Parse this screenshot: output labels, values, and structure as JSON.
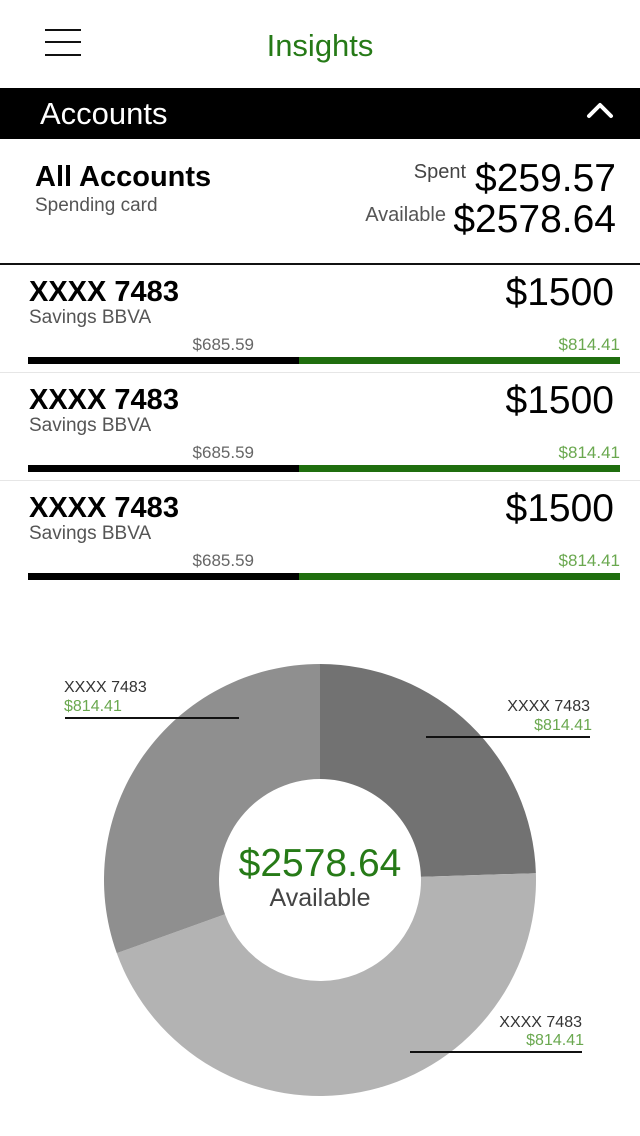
{
  "nav": {
    "title": "Insights"
  },
  "section": {
    "title": "Accounts"
  },
  "summary": {
    "title": "All Accounts",
    "subtitle": "Spending card",
    "spent_label": "Spent",
    "spent_value": "$259.57",
    "available_label": "Available",
    "available_value": "$2578.64"
  },
  "accounts": [
    {
      "name": "XXXX 7483",
      "type": "Savings BBVA",
      "limit": "$1500",
      "used": "$685.59",
      "available": "$814.41",
      "used_fraction": 0.457
    },
    {
      "name": "XXXX 7483",
      "type": "Savings BBVA",
      "limit": "$1500",
      "used": "$685.59",
      "available": "$814.41",
      "used_fraction": 0.457
    },
    {
      "name": "XXXX 7483",
      "type": "Savings BBVA",
      "limit": "$1500",
      "used": "$685.59",
      "available": "$814.41",
      "used_fraction": 0.457
    }
  ],
  "donut": {
    "center_value": "$2578.64",
    "center_label": "Available",
    "slices": [
      {
        "name": "XXXX 7483",
        "amount": "$814.41",
        "fraction": 0.245,
        "color": "#727272"
      },
      {
        "name": "XXXX 7483",
        "amount": "$814.41",
        "fraction": 0.45,
        "color": "#b3b3b3"
      },
      {
        "name": "XXXX 7483",
        "amount": "$814.41",
        "fraction": 0.305,
        "color": "#8f8f8f"
      }
    ]
  },
  "colors": {
    "accent": "#267a17",
    "bar_available": "#1f6e0e",
    "bar_used": "#000000",
    "amount_green": "#6aa84f"
  },
  "icons": {
    "menu": "hamburger-icon",
    "collapse": "chevron-up-icon"
  }
}
